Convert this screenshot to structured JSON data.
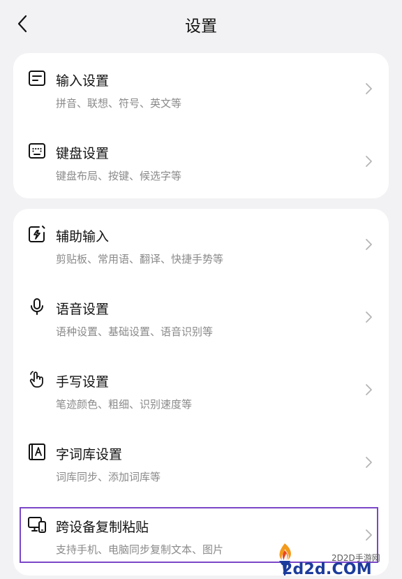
{
  "header": {
    "title": "设置"
  },
  "groups": [
    {
      "items": [
        {
          "label": "输入设置",
          "sub": "拼音、联想、符号、英文等",
          "icon": "input-settings-icon"
        },
        {
          "label": "键盘设置",
          "sub": "键盘布局、按键、候选字等",
          "icon": "keyboard-icon"
        }
      ]
    },
    {
      "items": [
        {
          "label": "辅助输入",
          "sub": "剪贴板、常用语、翻译、快捷手势等",
          "icon": "assist-input-icon"
        },
        {
          "label": "语音设置",
          "sub": "语种设置、基础设置、语音识别等",
          "icon": "microphone-icon"
        },
        {
          "label": "手写设置",
          "sub": "笔迹颜色、粗细、识别速度等",
          "icon": "handwriting-icon"
        },
        {
          "label": "字词库设置",
          "sub": "词库同步、添加词库等",
          "icon": "dictionary-icon"
        },
        {
          "label": "跨设备复制粘贴",
          "sub": "支持手机、电脑同步复制文本、图片",
          "icon": "cross-device-icon"
        }
      ]
    }
  ],
  "watermark": {
    "site": "2D2D手游网",
    "url": "2d2d.COM"
  },
  "colors": {
    "highlight": "#7b46c8",
    "background": "#f2f2f4",
    "card": "#ffffff",
    "subtext": "#8a8a8a"
  }
}
